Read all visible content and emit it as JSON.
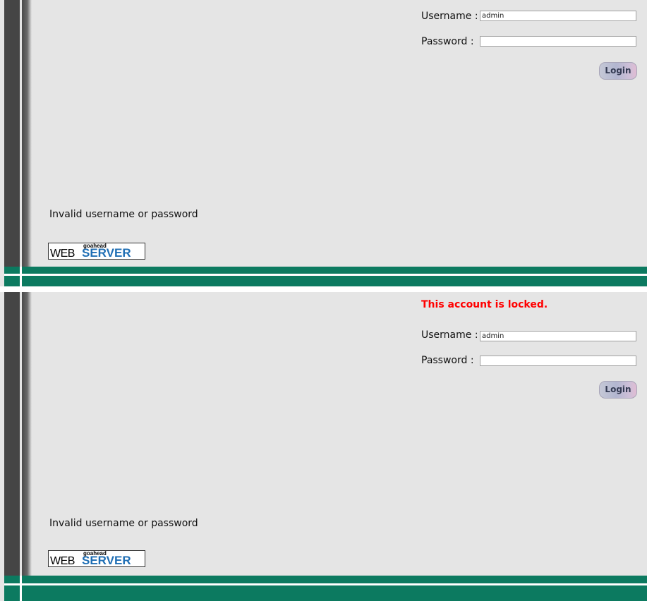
{
  "panels": [
    {
      "locked_message": "",
      "username_label": "Username :",
      "username_value": "admin",
      "password_label": "Password :",
      "password_value": "",
      "login_label": "Login",
      "error_message": "Invalid username or password",
      "logo": {
        "small": "goahead",
        "web": "WEB",
        "server": "SERVER"
      }
    },
    {
      "locked_message": "This account is locked.",
      "username_label": "Username :",
      "username_value": "admin",
      "password_label": "Password :",
      "password_value": "",
      "login_label": "Login",
      "error_message": "Invalid username or password",
      "logo": {
        "small": "goahead",
        "web": "WEB",
        "server": "SERVER"
      }
    }
  ],
  "colors": {
    "background": "#e5e5e5",
    "sidebar": "#454545",
    "footer_green": "#0c7a60",
    "locked_red": "#ff0000",
    "logo_blue": "#1e6eb4"
  }
}
